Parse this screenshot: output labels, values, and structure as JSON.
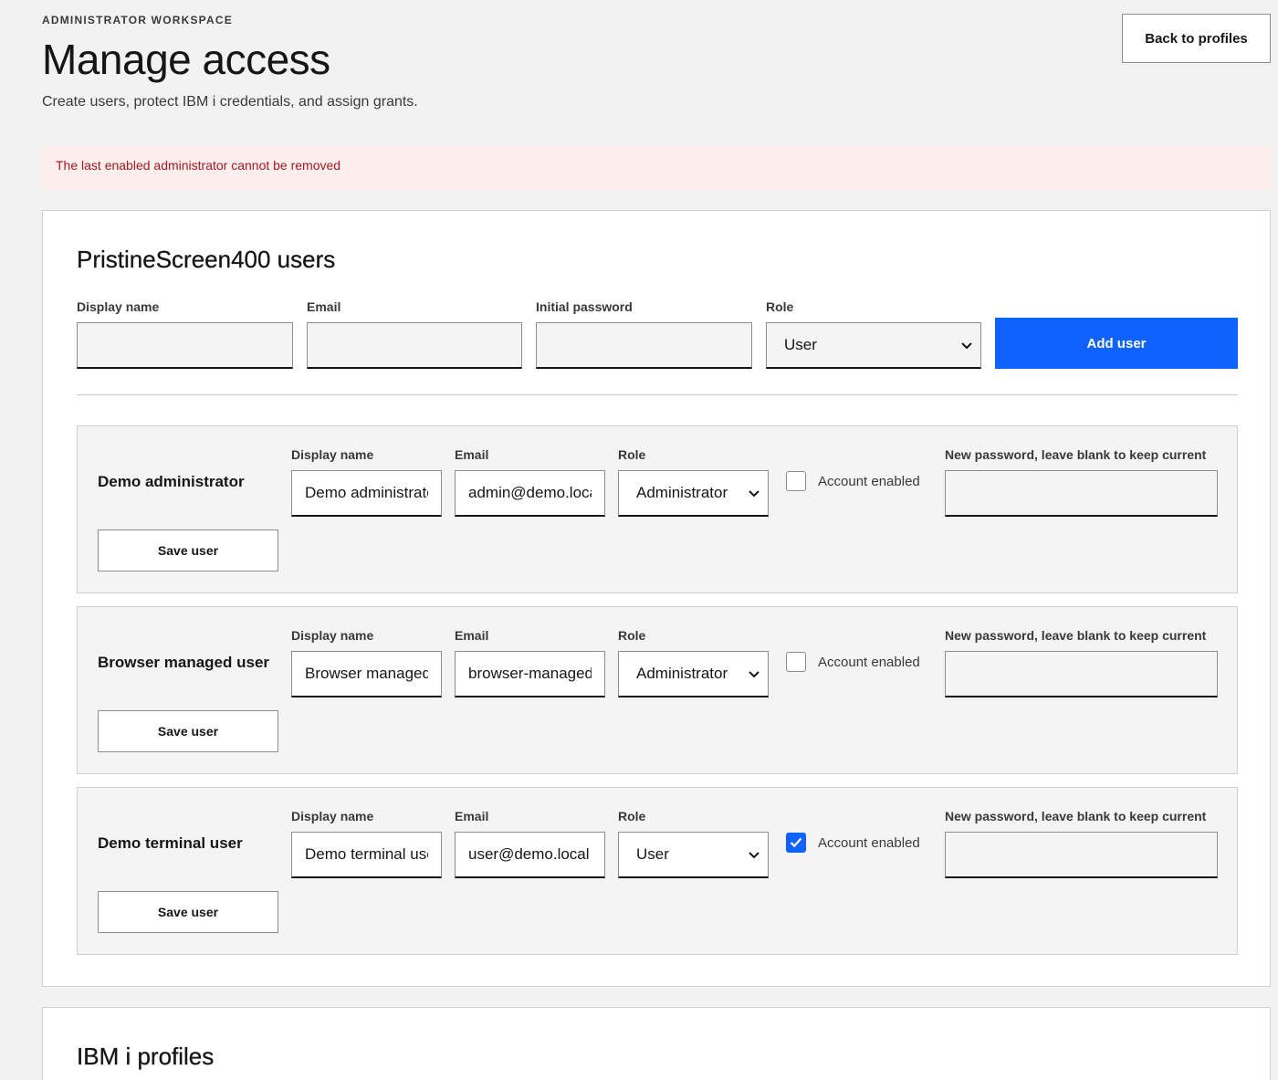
{
  "header": {
    "eyebrow": "ADMINISTRATOR WORKSPACE",
    "title": "Manage access",
    "subtitle": "Create users, protect IBM i credentials, and assign grants.",
    "back_label": "Back to profiles"
  },
  "error": "The last enabled administrator cannot be removed",
  "users_panel": {
    "title": "PristineScreen400 users",
    "new_user": {
      "display_name_label": "Display name",
      "email_label": "Email",
      "password_label": "Initial password",
      "role_label": "Role",
      "display_name_value": "",
      "email_value": "",
      "password_value": "",
      "role_value": "User",
      "add_label": "Add user"
    },
    "users": [
      {
        "name": "Demo administrator",
        "display_name_label": "Display name",
        "display_name": "Demo administrator",
        "email_label": "Email",
        "email": "admin@demo.local",
        "role_label": "Role",
        "role": "Administrator",
        "enabled_label": "Account enabled",
        "enabled": false,
        "password_label": "New password, leave blank to keep current",
        "password": "",
        "save_label": "Save user"
      },
      {
        "name": "Browser managed user",
        "display_name_label": "Display name",
        "display_name": "Browser managed user",
        "email_label": "Email",
        "email": "browser-managed@demo.local",
        "role_label": "Role",
        "role": "Administrator",
        "enabled_label": "Account enabled",
        "enabled": false,
        "password_label": "New password, leave blank to keep current",
        "password": "",
        "save_label": "Save user"
      },
      {
        "name": "Demo terminal user",
        "display_name_label": "Display name",
        "display_name": "Demo terminal user",
        "email_label": "Email",
        "email": "user@demo.local",
        "role_label": "Role",
        "role": "User",
        "enabled_label": "Account enabled",
        "enabled": true,
        "password_label": "New password, leave blank to keep current",
        "password": "",
        "save_label": "Save user"
      }
    ]
  },
  "profiles_panel": {
    "title": "IBM i profiles"
  },
  "colors": {
    "primary": "#0f62fe",
    "error_bg": "#fdeeee",
    "error_text": "#a2191f"
  }
}
